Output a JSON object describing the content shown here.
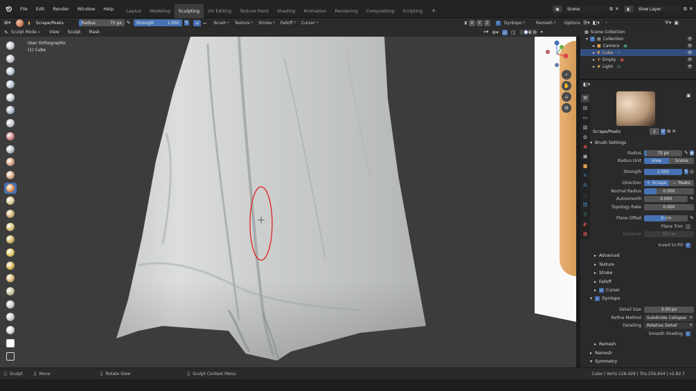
{
  "menu": [
    "File",
    "Edit",
    "Render",
    "Window",
    "Help"
  ],
  "workspaces": [
    "Layout",
    "Modeling",
    "Sculpting",
    "UV Editing",
    "Texture Paint",
    "Shading",
    "Animation",
    "Rendering",
    "Compositing",
    "Scripting"
  ],
  "active_workspace": "Sculpting",
  "scene": {
    "label": "Scene",
    "view_layer": "View Layer"
  },
  "toolsettings": {
    "brush_name": "Scrape/Peaks",
    "radius_label": "Radius",
    "radius_value": "75 px",
    "strength_label": "Strength",
    "strength_value": "1.000",
    "menus": [
      "Brush",
      "Texture",
      "Stroke",
      "Falloff",
      "Cursor"
    ],
    "dyntopo": "Dyntopo",
    "remesh": "Remesh",
    "options": "Options"
  },
  "header": {
    "mode": "Sculpt Mode",
    "menus": [
      "View",
      "Sculpt",
      "Mask"
    ]
  },
  "viewport": {
    "view_name": "User Orthographic",
    "object_name": "(1) Cube"
  },
  "status": {
    "left": "Sculpt",
    "move": "Move",
    "rotate": "Rotate View",
    "context": "Sculpt Context Menu",
    "stats": "Cube | Verts:128,428 | Tris:256,844 | v2.82.7"
  },
  "outliner": {
    "search_placeholder": "",
    "rows": [
      {
        "label": "Scene Collection"
      },
      {
        "label": "Collection"
      },
      {
        "label": "Camera"
      },
      {
        "label": "Cube"
      },
      {
        "label": "Empty"
      },
      {
        "label": "Light"
      }
    ]
  },
  "brush_panel": {
    "name": "Scrape/Peaks",
    "users": "2",
    "section": "Brush Settings",
    "radius_label": "Radius",
    "radius": "75 px",
    "radius_unit_label": "Radius Unit",
    "unit_view": "View",
    "unit_scene": "Scene",
    "strength_label": "Strength",
    "strength": "1.000",
    "direction_label": "Direction",
    "dir_scrape": "Scrape",
    "dir_peaks": "Peaks",
    "normal_radius_label": "Normal Radius",
    "normal_radius": "0.500",
    "autosmooth_label": "Autosmooth",
    "autosmooth": "0.000",
    "topology_rake_label": "Topology Rake",
    "topology_rake": "0.000",
    "plane_offset_label": "Plane Offset",
    "plane_offset": "0 cm",
    "plane_trim_label": "Plane Trim",
    "distance_label": "Distance",
    "distance": "50 cm",
    "invert_label": "Invert to Fill",
    "subpanels": [
      "Advanced",
      "Texture",
      "Stroke",
      "Falloff",
      "Cursor"
    ],
    "dyntopo_label": "Dyntopo",
    "detail_size_label": "Detail Size",
    "detail_size": "3.00 px",
    "refine_label": "Refine Method",
    "refine": "Subdivide Collapse",
    "detailing_label": "Detailing",
    "detailing": "Relative Detail",
    "smooth_label": "Smooth Shading",
    "remesh_sub": "Remesh",
    "remesh_section": "Remesh",
    "symmetry_section": "Symmetry"
  },
  "gizmo": {
    "x": "X",
    "y": "Y",
    "z": "Z"
  },
  "colors": {
    "accent": "#4772b3",
    "selection": "#334d80",
    "stroke_circle": "#e02020"
  }
}
